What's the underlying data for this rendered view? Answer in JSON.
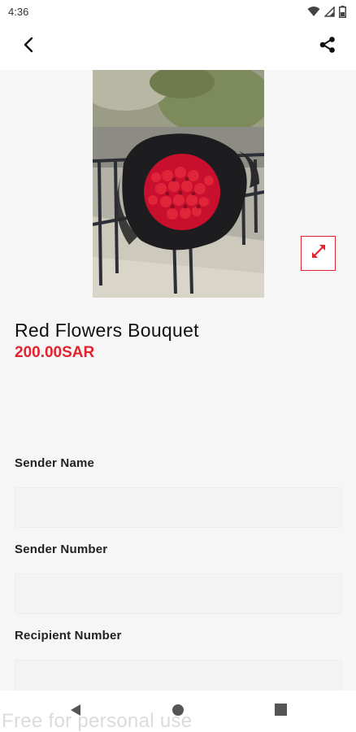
{
  "status_bar": {
    "time": "4:36",
    "icons": [
      "wifi-icon",
      "cell-signal-icon",
      "battery-icon"
    ]
  },
  "app_bar": {
    "back_icon": "chevron-left-icon",
    "share_icon": "share-icon"
  },
  "product": {
    "image_description_icon": "flower-bouquet-photo",
    "expand_icon": "expand-arrows-icon",
    "title": "Red Flowers Bouquet",
    "price": "200.00SAR"
  },
  "form": {
    "sender_name": {
      "label": "Sender Name",
      "value": "",
      "placeholder": ""
    },
    "sender_number": {
      "label": "Sender Number",
      "value": "",
      "placeholder": ""
    },
    "recipient_number": {
      "label": "Recipient Number",
      "value": "",
      "placeholder": ""
    }
  },
  "nav_bar": {
    "icons": [
      "back-triangle-icon",
      "home-circle-icon",
      "recents-square-icon"
    ]
  },
  "watermark": "Free for personal use",
  "colors": {
    "accent": "#e0232e",
    "background": "#f6f6f6",
    "surface": "#ffffff"
  }
}
